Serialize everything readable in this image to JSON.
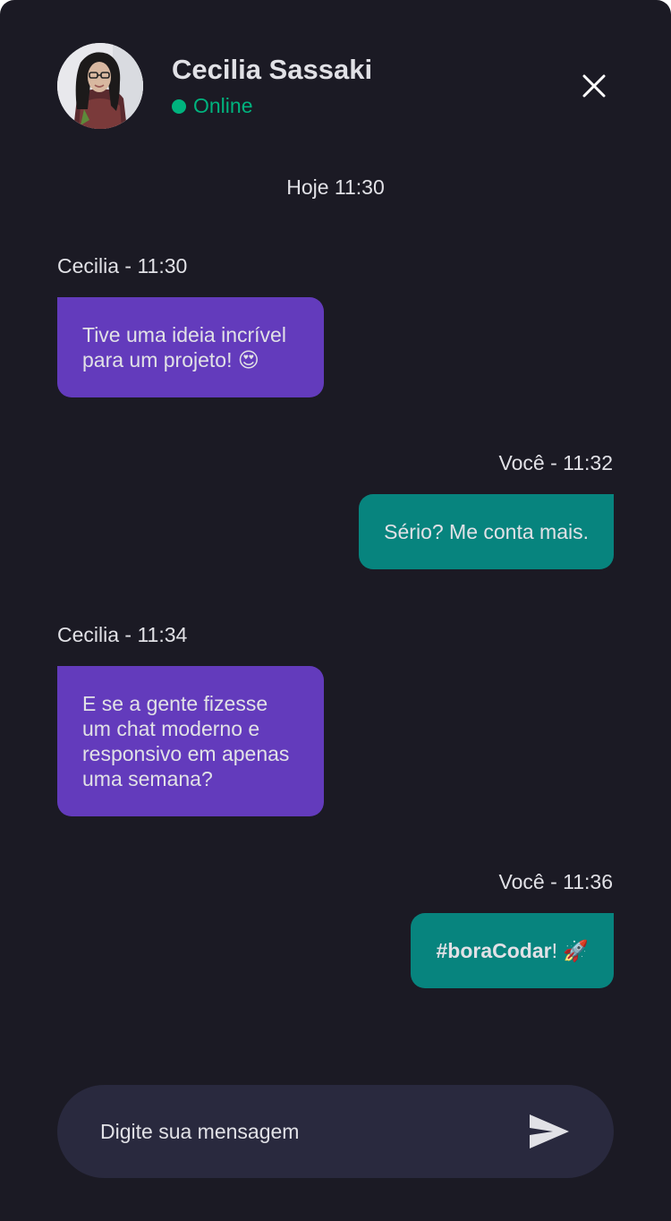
{
  "contact": {
    "name": "Cecilia Sassaki",
    "status": "Online",
    "status_color": "#00b37e"
  },
  "day_stamp": "Hoje 11:30",
  "messages": [
    {
      "sender": "Cecilia",
      "meta": "Cecilia - 11:30",
      "lines": [
        "Tive uma ideia incrível",
        "para um projeto! 😍"
      ]
    },
    {
      "sender": "Você",
      "meta": "Você - 11:32",
      "lines": [
        "Sério? Me conta mais."
      ]
    },
    {
      "sender": "Cecilia",
      "meta": "Cecilia - 11:34",
      "lines": [
        "E se a gente fizesse",
        "um chat moderno e",
        "responsivo em apenas",
        "uma semana?"
      ]
    },
    {
      "sender": "Você",
      "meta": "Você - 11:36",
      "hashtag": "#boraCodar",
      "suffix": "! 🚀"
    }
  ],
  "composer": {
    "placeholder": "Digite sua mensagem"
  },
  "icons": {
    "close": "close-icon",
    "send": "send-icon",
    "avatar": "avatar"
  },
  "colors": {
    "background": "#1b1a24",
    "incoming_bubble": "#633bbc",
    "outgoing_bubble": "#07847e",
    "composer": "#29293e",
    "text": "#e1e1e6"
  }
}
